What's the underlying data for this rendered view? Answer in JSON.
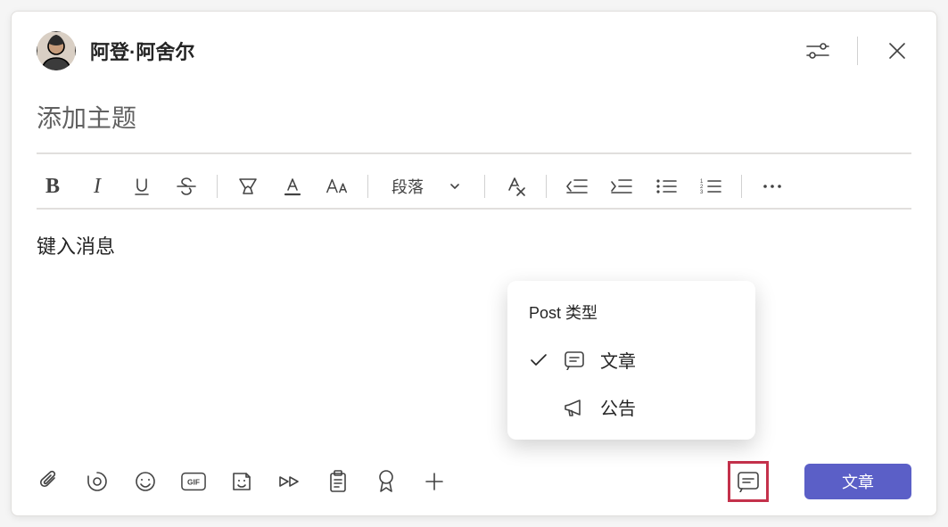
{
  "header": {
    "author_name": "阿登·阿舍尔"
  },
  "subject": {
    "placeholder": "添加主题",
    "value": ""
  },
  "format_toolbar": {
    "style_dropdown_label": "段落"
  },
  "body": {
    "placeholder": "键入消息",
    "value": ""
  },
  "post_type_popup": {
    "title": "Post 类型",
    "items": [
      {
        "label": "文章",
        "selected": true
      },
      {
        "label": "公告",
        "selected": false
      }
    ]
  },
  "send_button": {
    "label": "文章"
  },
  "icons": {
    "settings": "settings-sliders-icon",
    "close": "close-icon",
    "bold": "bold-icon",
    "italic": "italic-icon",
    "underline": "underline-icon",
    "strike": "strikethrough-icon",
    "highlight": "highlighter-icon",
    "font_color": "font-color-icon",
    "font_size": "font-size-icon",
    "clear_format": "clear-formatting-icon",
    "indent_dec": "decrease-indent-icon",
    "indent_inc": "increase-indent-icon",
    "bullets": "bullet-list-icon",
    "numbered": "numbered-list-icon",
    "more": "more-icon",
    "attach": "paperclip-icon",
    "loop": "loop-icon",
    "emoji": "emoji-icon",
    "gif": "gif-icon",
    "sticker": "sticker-icon",
    "stream": "stream-icon",
    "updates": "clipboard-icon",
    "praise": "praise-badge-icon",
    "plus": "plus-icon",
    "post_type": "post-type-icon",
    "conversation": "conversation-icon",
    "announcement": "megaphone-icon",
    "check": "check-icon",
    "chevron_down": "chevron-down-icon"
  }
}
